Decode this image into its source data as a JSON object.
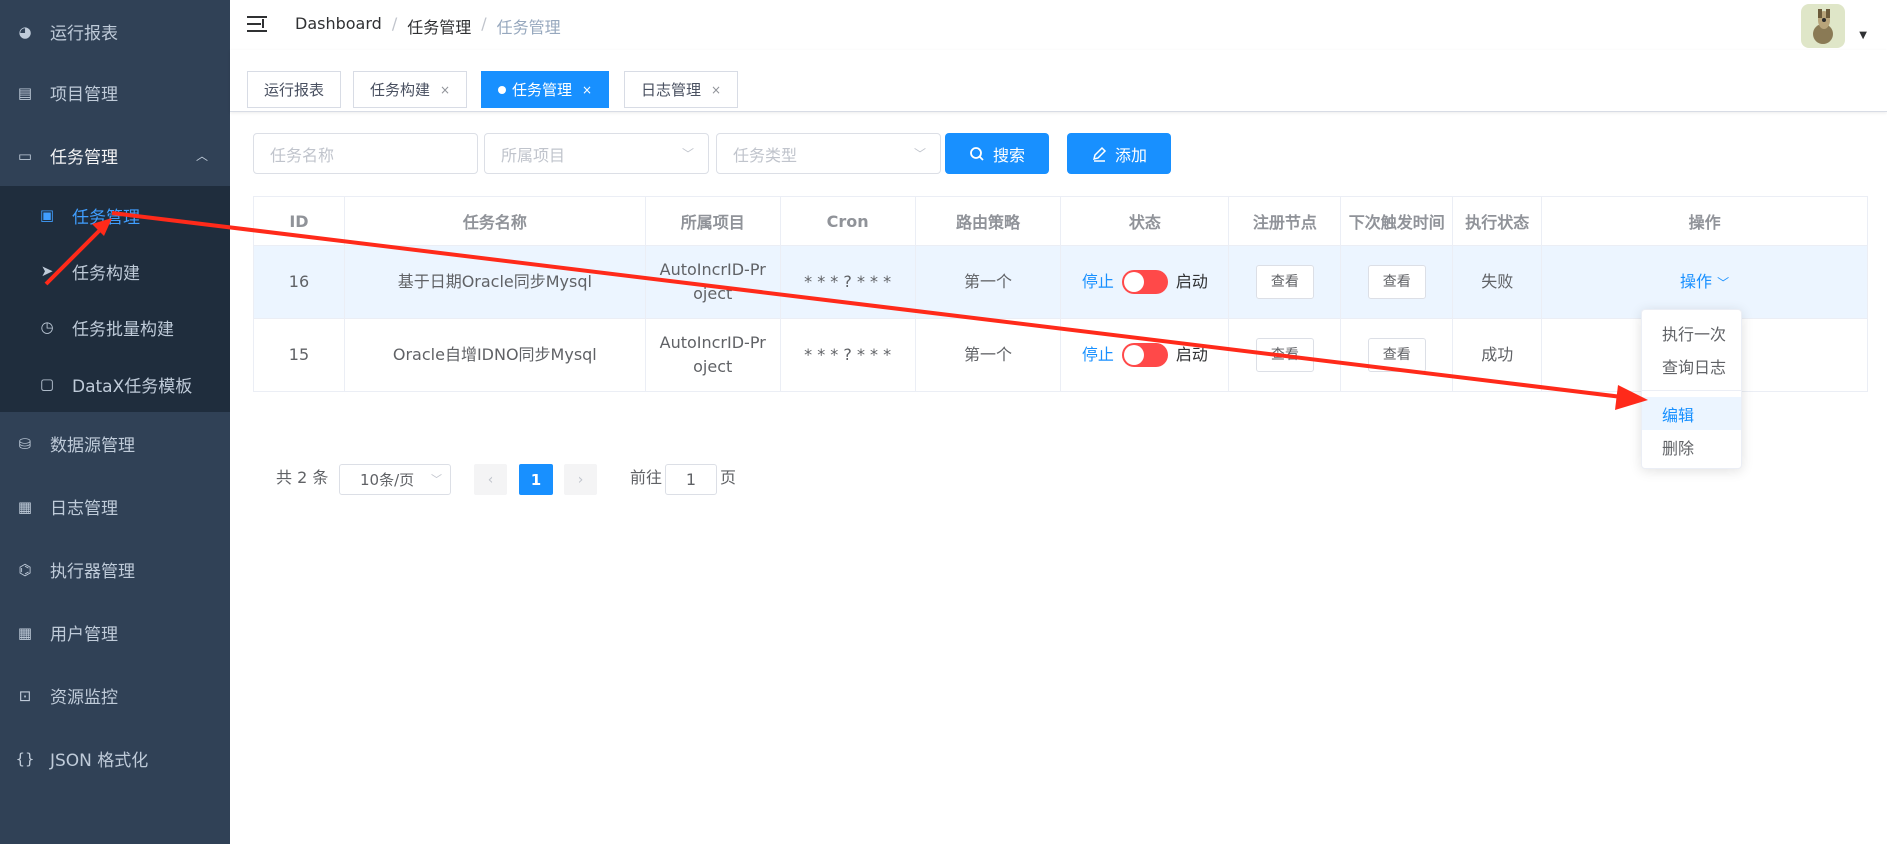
{
  "sidebar": {
    "items": [
      {
        "label": "运行报表",
        "icon": "dashboard-icon",
        "glyph": "◕"
      },
      {
        "label": "项目管理",
        "icon": "project-icon",
        "glyph": "▤"
      },
      {
        "label": "任务管理",
        "icon": "monitor-icon",
        "glyph": "▭"
      },
      {
        "label": "数据源管理",
        "icon": "database-icon",
        "glyph": "⛁"
      },
      {
        "label": "日志管理",
        "icon": "log-icon",
        "glyph": "▦"
      },
      {
        "label": "执行器管理",
        "icon": "executor-icon",
        "glyph": "⌬"
      },
      {
        "label": "用户管理",
        "icon": "table-icon",
        "glyph": "▦"
      },
      {
        "label": "资源监控",
        "icon": "monitor-resource-icon",
        "glyph": "⊡"
      },
      {
        "label": "JSON 格式化",
        "icon": "json-icon",
        "glyph": "{}"
      }
    ],
    "sub_items": [
      {
        "label": "任务管理",
        "icon": "calendar-icon",
        "glyph": "▣"
      },
      {
        "label": "任务构建",
        "icon": "send-icon",
        "glyph": "➤"
      },
      {
        "label": "任务批量构建",
        "icon": "batch-icon",
        "glyph": "◷"
      },
      {
        "label": "DataX任务模板",
        "icon": "template-icon",
        "glyph": "▢"
      }
    ],
    "collapse_glyph": "︿"
  },
  "navbar": {
    "breadcrumb": [
      "Dashboard",
      "任务管理",
      "任务管理"
    ],
    "sep": "/"
  },
  "tags": [
    {
      "label": "运行报表"
    },
    {
      "label": "任务构建",
      "close": "×"
    },
    {
      "label": "任务管理",
      "close": "×"
    },
    {
      "label": "日志管理",
      "close": "×"
    }
  ],
  "filters": {
    "task_name_placeholder": "任务名称",
    "project_placeholder": "所属项目",
    "type_placeholder": "任务类型",
    "search_label": "搜索",
    "add_label": "添加"
  },
  "table": {
    "headers": [
      "ID",
      "任务名称",
      "所属项目",
      "Cron",
      "路由策略",
      "状态",
      "注册节点",
      "下次触发时间",
      "执行状态",
      "操作"
    ],
    "rows": [
      {
        "id": "16",
        "name": "基于日期Oracle同步Mysql",
        "project": "AutoIncrID-Project",
        "cron": "* * * ? * * *",
        "route": "第一个",
        "stop": "停止",
        "start": "启动",
        "node": "查看",
        "next": "查看",
        "exec": "失败",
        "op": "操作"
      },
      {
        "id": "15",
        "name": "Oracle自增IDNO同步Mysql",
        "project": "AutoIncrID-Project",
        "cron": "* * * ? * * *",
        "route": "第一个",
        "stop": "停止",
        "start": "启动",
        "node": "查看",
        "next": "查看",
        "exec": "成功",
        "op": ""
      }
    ]
  },
  "dropdown": {
    "items": [
      "执行一次",
      "查询日志",
      "编辑",
      "删除"
    ]
  },
  "pagination": {
    "total": "共 2 条",
    "page_size": "10条/页",
    "current_page": "1",
    "goto_label": "前往",
    "goto_value": "1",
    "page_suffix": "页"
  },
  "colors": {
    "accent": "#1890ff",
    "sidebar": "#304156",
    "switch_off": "#ff4949",
    "annotation": "#ff2a1a"
  }
}
